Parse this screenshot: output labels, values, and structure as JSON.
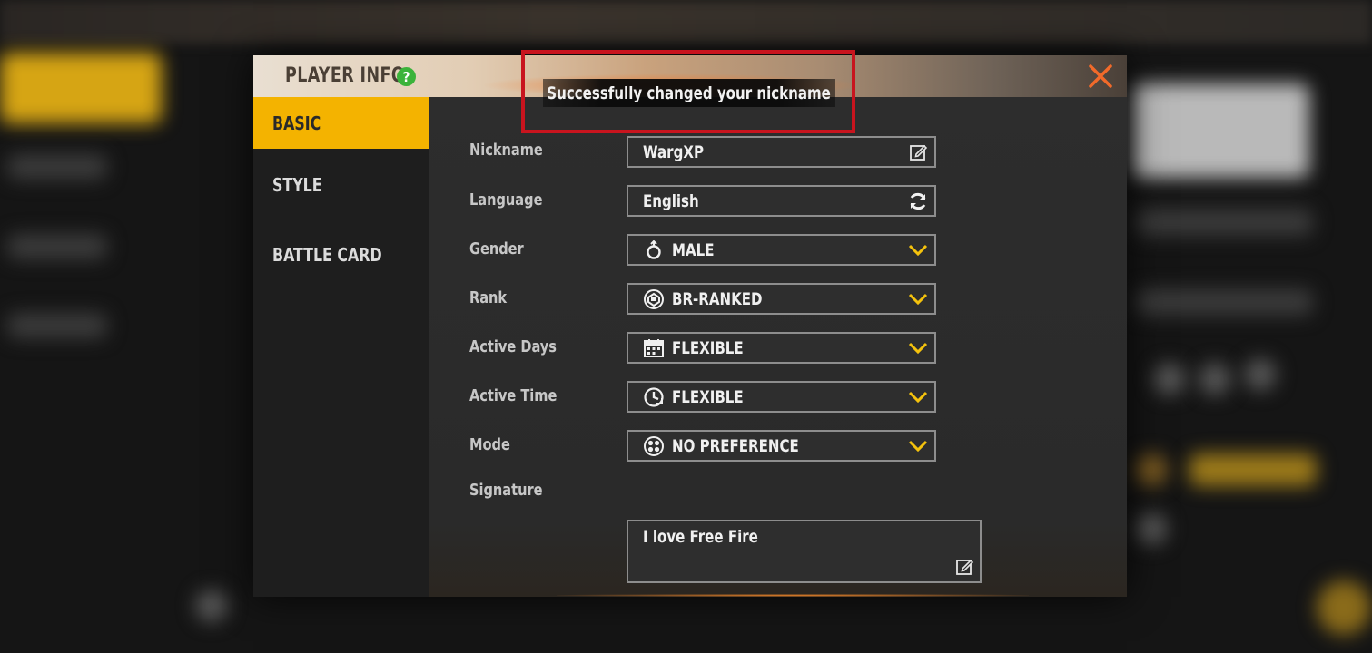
{
  "modal": {
    "title": "PLAYER INFO",
    "help_glyph": "?"
  },
  "nav": {
    "items": [
      {
        "label": "BASIC",
        "active": true
      },
      {
        "label": "STYLE",
        "active": false
      },
      {
        "label": "BATTLE CARD",
        "active": false
      }
    ]
  },
  "form": {
    "nickname": {
      "label": "Nickname",
      "value": "WargXP",
      "icon": "edit-icon"
    },
    "language": {
      "label": "Language",
      "value": "English",
      "icon": "refresh-icon"
    },
    "gender": {
      "label": "Gender",
      "value": "MALE",
      "icon": "male-icon"
    },
    "rank": {
      "label": "Rank",
      "value": "BR-RANKED",
      "icon": "rank-icon"
    },
    "active_days": {
      "label": "Active Days",
      "value": "FLEXIBLE",
      "icon": "calendar-icon"
    },
    "active_time": {
      "label": "Active Time",
      "value": "FLEXIBLE",
      "icon": "clock-icon"
    },
    "mode": {
      "label": "Mode",
      "value": "NO PREFERENCE",
      "icon": "mode-icon"
    },
    "signature": {
      "label": "Signature",
      "value": "I love Free Fire",
      "icon": "edit-icon"
    }
  },
  "toast": {
    "message": "Successfully changed your nickname"
  },
  "colors": {
    "accent_yellow": "#f4b300",
    "close_orange": "#f26a2a",
    "highlight_red": "#c8141e",
    "help_green": "#3bb33b",
    "chevron_yellow": "#f4c20d"
  }
}
